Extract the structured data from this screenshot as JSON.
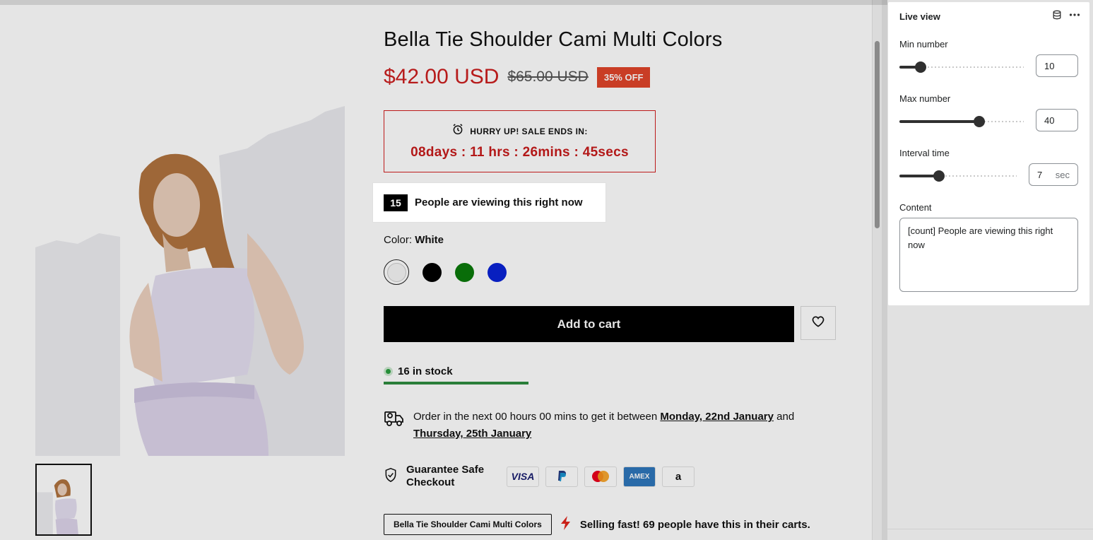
{
  "product": {
    "title": "Bella Tie Shoulder Cami Multi Colors",
    "price_sale": "$42.00 USD",
    "price_compare": "$65.00 USD",
    "discount_badge": "35% OFF",
    "countdown_heading": "HURRY UP! SALE ENDS IN:",
    "countdown_time": "08days :  11 hrs : 26mins : 45secs",
    "live_count": "15",
    "live_text": "People are viewing this right now",
    "color_label": "Color:",
    "color_value": "White",
    "swatches": [
      {
        "name": "White",
        "color": "#f5f5f5"
      },
      {
        "name": "Black",
        "color": "#000000"
      },
      {
        "name": "Green",
        "color": "#0b7a0b"
      },
      {
        "name": "Blue",
        "color": "#0a23d6"
      }
    ],
    "add_to_cart": "Add to cart",
    "stock_text": "16 in stock",
    "stock_fill_fraction": 1.0,
    "delivery_prefix": "Order in the next 00 hours 00 mins to get it between ",
    "delivery_date1": "Monday, 22nd January",
    "delivery_and": " and ",
    "delivery_date2": "Thursday, 25th January",
    "guarantee_text": "Guarantee Safe Checkout",
    "payment_methods": [
      "VISA",
      "PayPal",
      "Mastercard",
      "AMEX",
      "a"
    ],
    "selling_chip": "Bella Tie Shoulder Cami Multi Colors",
    "selling_text": "Selling fast! 69 people have this in their carts."
  },
  "panel": {
    "title": "Live view",
    "min_label": "Min number",
    "min_value": "10",
    "min_slider_fraction": 0.17,
    "max_label": "Max number",
    "max_value": "40",
    "max_slider_fraction": 0.64,
    "interval_label": "Interval time",
    "interval_value": "7",
    "interval_suffix": "sec",
    "interval_slider_fraction": 0.34,
    "content_label": "Content",
    "content_value": "[count] People are viewing this right now"
  },
  "colors": {
    "sale_red": "#cc1f1f",
    "discount_bg": "#e0452a",
    "stock_green": "#2f8d40"
  }
}
